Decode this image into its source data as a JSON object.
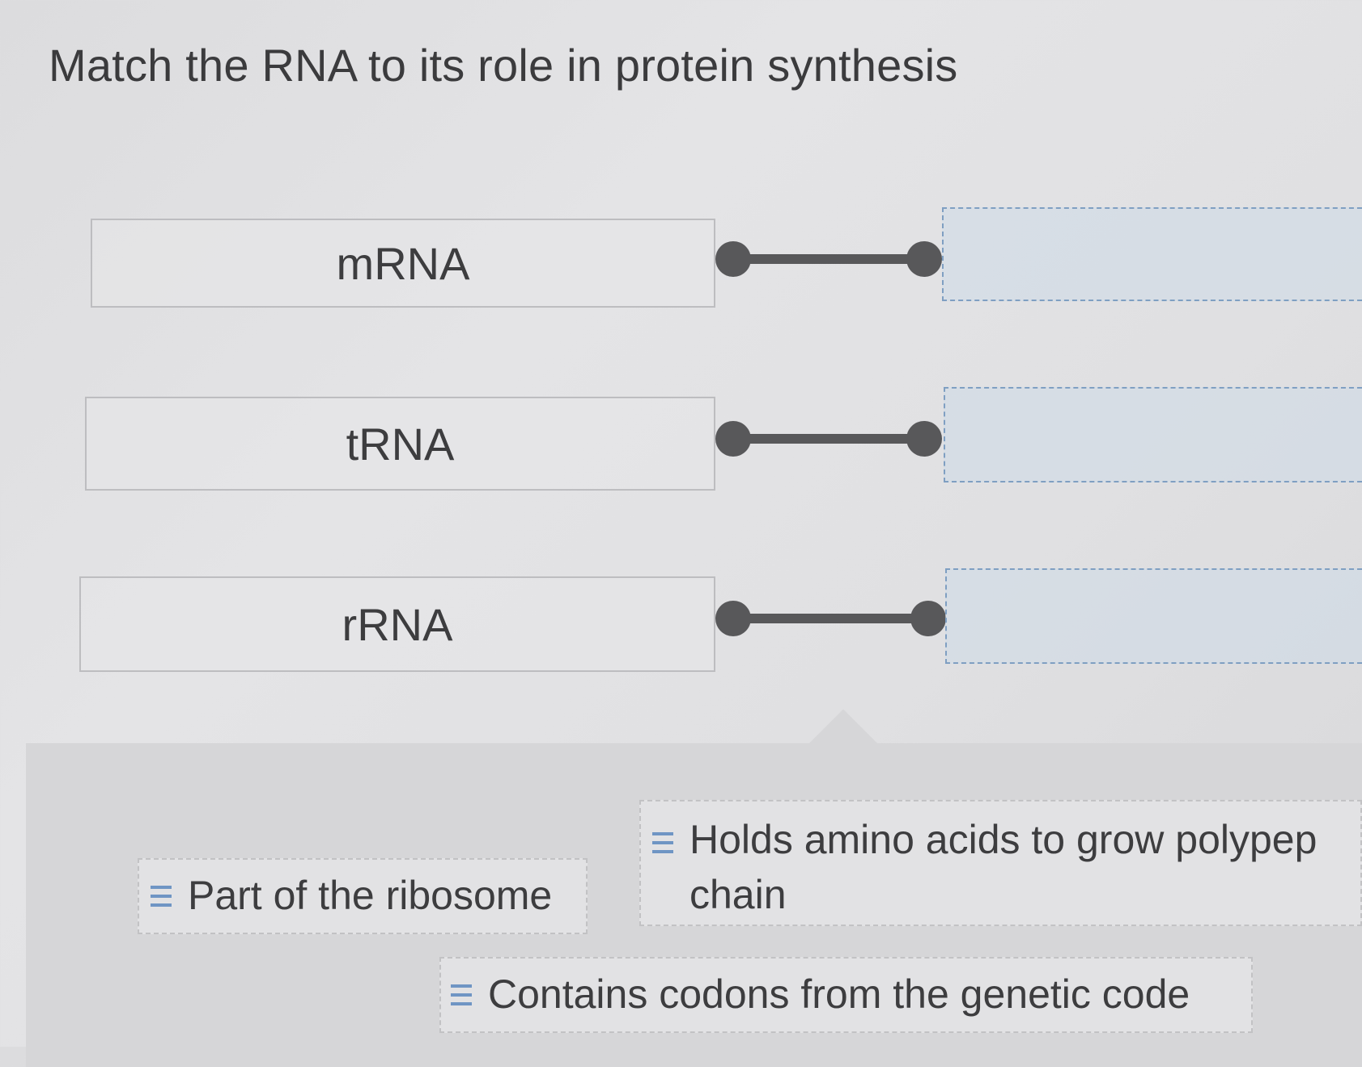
{
  "question": {
    "title": "Match the RNA to its role in protein synthesis"
  },
  "rna_items": [
    {
      "label": "mRNA"
    },
    {
      "label": "tRNA"
    },
    {
      "label": "rRNA"
    }
  ],
  "answer_chips": [
    {
      "label": "Part of the ribosome",
      "icon": "drag-handle-icon"
    },
    {
      "label_line1": "Holds amino acids to grow polypep",
      "label_line2": "chain",
      "icon": "drag-handle-icon"
    },
    {
      "label": "Contains codons from the genetic code",
      "icon": "drag-handle-icon"
    }
  ],
  "colors": {
    "connector": "#58585a",
    "drop_target_border": "#7f9fc2",
    "handle_accent": "#6f95c4"
  }
}
